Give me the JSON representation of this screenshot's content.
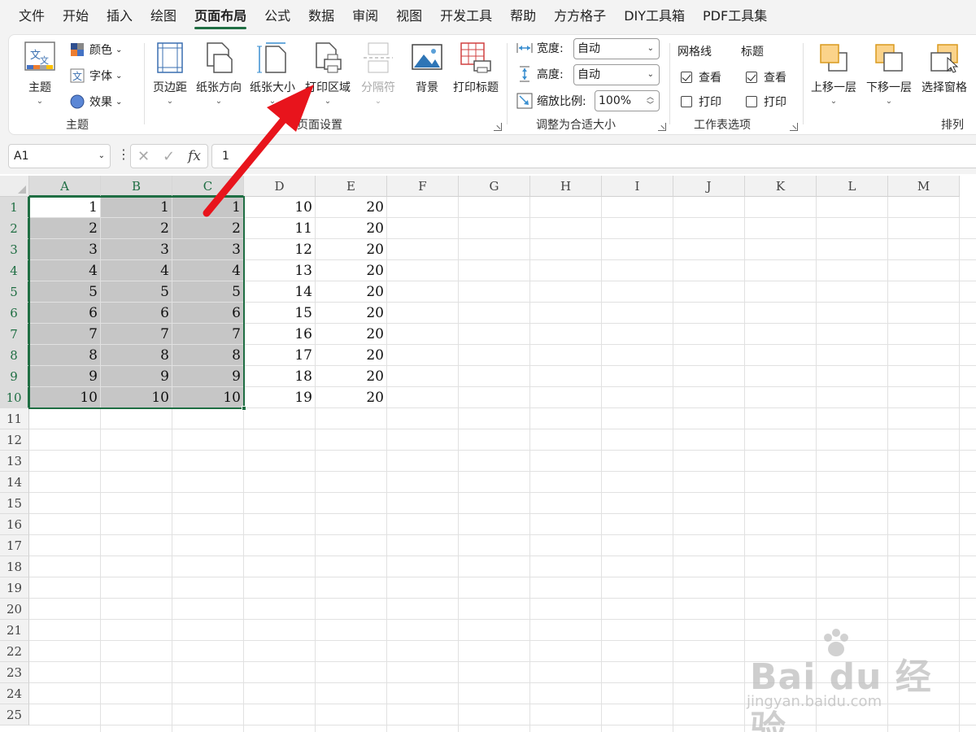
{
  "menu": [
    "文件",
    "开始",
    "插入",
    "绘图",
    "页面布局",
    "公式",
    "数据",
    "审阅",
    "视图",
    "开发工具",
    "帮助",
    "方方格子",
    "DIY工具箱",
    "PDF工具集"
  ],
  "menu_active": "页面布局",
  "ribbon": {
    "theme_group": {
      "label": "主题",
      "theme_button": "主题",
      "colors": "颜色",
      "fonts": "字体",
      "effects": "效果"
    },
    "page_setup_group": {
      "label": "页面设置",
      "margins": "页边距",
      "orientation": "纸张方向",
      "size": "纸张大小",
      "print_area": "打印区域",
      "breaks": "分隔符",
      "background": "背景",
      "print_titles": "打印标题"
    },
    "scale_group": {
      "label": "调整为合适大小",
      "width_label": "宽度:",
      "width_value": "自动",
      "height_label": "高度:",
      "height_value": "自动",
      "scale_label": "缩放比例:",
      "scale_value": "100%"
    },
    "sheet_options_group": {
      "label": "工作表选项",
      "gridlines": "网格线",
      "headings": "标题",
      "view": "查看",
      "print": "打印"
    },
    "arrange_group": {
      "label": "排列",
      "bring_forward": "上移一层",
      "send_backward": "下移一层",
      "selection_pane": "选择窗格"
    }
  },
  "formula_bar": {
    "name_box": "A1",
    "content": "1"
  },
  "columns": [
    "A",
    "B",
    "C",
    "D",
    "E",
    "F",
    "G",
    "H",
    "I",
    "J",
    "K",
    "L",
    "M"
  ],
  "rows": [
    "1",
    "2",
    "3",
    "4",
    "5",
    "6",
    "7",
    "8",
    "9",
    "10",
    "11",
    "12",
    "13",
    "14",
    "15",
    "16",
    "17",
    "18",
    "19",
    "20",
    "21",
    "22",
    "23",
    "24",
    "25"
  ],
  "cells": {
    "A": [
      "1",
      "2",
      "3",
      "4",
      "5",
      "6",
      "7",
      "8",
      "9",
      "10"
    ],
    "B": [
      "1",
      "2",
      "3",
      "4",
      "5",
      "6",
      "7",
      "8",
      "9",
      "10"
    ],
    "C": [
      "1",
      "2",
      "3",
      "4",
      "5",
      "6",
      "7",
      "8",
      "9",
      "10"
    ],
    "D": [
      "10",
      "11",
      "12",
      "13",
      "14",
      "15",
      "16",
      "17",
      "18",
      "19"
    ],
    "E": [
      "20",
      "20",
      "20",
      "20",
      "20",
      "20",
      "20",
      "20",
      "20",
      "20"
    ]
  },
  "selection": "A1:C10",
  "watermark": {
    "logo": "Bai du 经验",
    "sub": "jingyan.baidu.com"
  },
  "colors": {
    "accent_green": "#1f6e43",
    "annotation_red": "#e8141c",
    "selection_fill": "#c6c6c6"
  }
}
